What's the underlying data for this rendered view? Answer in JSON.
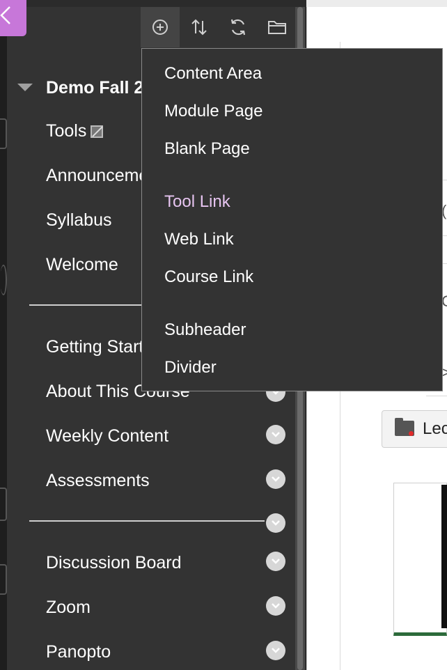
{
  "toolbar": {
    "buttons": [
      {
        "name": "add-menu-item",
        "icon": "plus-circle-icon",
        "active": true
      },
      {
        "name": "reorder",
        "icon": "sort-arrows-icon"
      },
      {
        "name": "refresh",
        "icon": "refresh-icon"
      },
      {
        "name": "manage-folders",
        "icon": "folder-icon"
      }
    ]
  },
  "course": {
    "title": "Demo Fall 2"
  },
  "course_menu": {
    "items": [
      {
        "label": "Tools",
        "icon": "hidden-from-students-icon"
      },
      {
        "label": "Announcements"
      },
      {
        "label": "Syllabus"
      },
      {
        "label": "Welcome"
      },
      {
        "label": "Getting Started"
      },
      {
        "label": "About This Course"
      },
      {
        "label": "Weekly Content"
      },
      {
        "label": "Assessments"
      },
      {
        "label": "Discussion Board"
      },
      {
        "label": "Zoom"
      },
      {
        "label": "Panopto"
      }
    ]
  },
  "add_menu": {
    "items": [
      {
        "label": "Content Area"
      },
      {
        "label": "Module Page"
      },
      {
        "label": "Blank Page"
      },
      {
        "label": "Tool Link",
        "hover": true
      },
      {
        "label": "Web Link"
      },
      {
        "label": "Course Link"
      },
      {
        "label": "Subheader"
      },
      {
        "label": "Divider"
      }
    ]
  },
  "content": {
    "lecture_button_label": "Lec",
    "panel_letters": [
      "(",
      "C",
      ">"
    ]
  },
  "colors": {
    "sidebar_bg": "#333333",
    "menu_text": "#ffffff",
    "hover_text": "#e6c4f0",
    "back_corner": "#c777d9",
    "chevron_bg": "#d7d7d7"
  }
}
